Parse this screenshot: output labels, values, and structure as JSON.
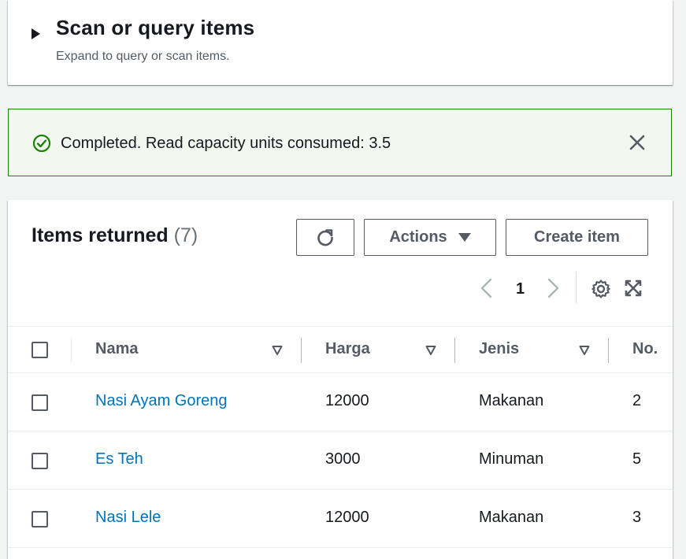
{
  "scan_panel": {
    "title": "Scan or query items",
    "subtitle": "Expand to query or scan items."
  },
  "alert": {
    "message": "Completed. Read capacity units consumed: 3.5",
    "status_color": "#1d8102"
  },
  "items": {
    "title": "Items returned",
    "count": "(7)",
    "actions_label": "Actions",
    "create_label": "Create item",
    "page": "1",
    "columns": [
      "Nama",
      "Harga",
      "Jenis",
      "No."
    ],
    "rows": [
      {
        "nama": "Nasi Ayam Goreng",
        "harga": "12000",
        "jenis": "Makanan",
        "no": "2"
      },
      {
        "nama": "Es Teh",
        "harga": "3000",
        "jenis": "Minuman",
        "no": "5"
      },
      {
        "nama": "Nasi Lele",
        "harga": "12000",
        "jenis": "Makanan",
        "no": "3"
      }
    ],
    "link_color": "#0073bb"
  }
}
